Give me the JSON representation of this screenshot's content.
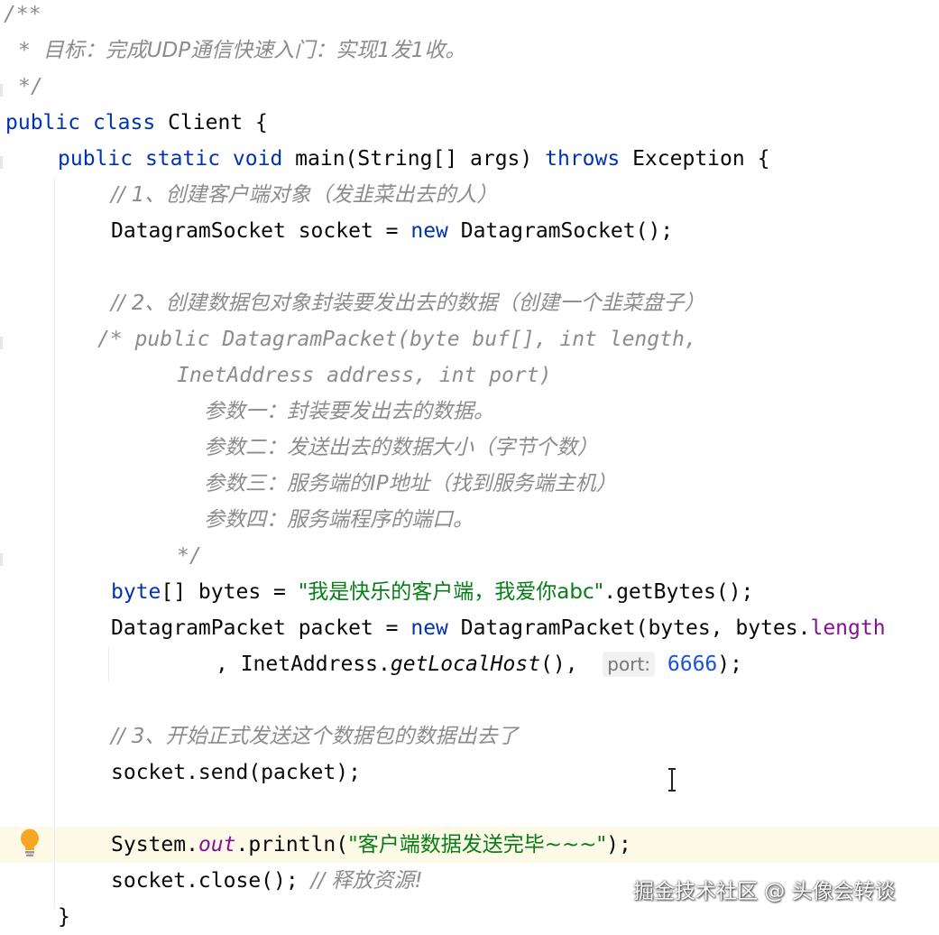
{
  "doc_comment": {
    "open": "/**",
    "star": "*",
    "text": "目标：完成UDP通信快速入门：实现1发1收。",
    "close": "*/"
  },
  "class_decl": {
    "kw1": "public",
    "kw2": "class",
    "name": "Client",
    "brace": "{"
  },
  "main_decl": {
    "kw1": "public",
    "kw2": "static",
    "kw3": "void",
    "signature": "main(String[] args)",
    "kw4": "throws",
    "exception": "Exception",
    "brace": "{"
  },
  "comment1": "// 1、创建客户端对象（发韭菜出去的人）",
  "socket_decl": {
    "type": "DatagramSocket socket = ",
    "kw": "new",
    "call": " DatagramSocket();"
  },
  "comment2": "// 2、创建数据包对象封装要发出去的数据（创建一个韭菜盘子）",
  "block_comment": {
    "line1": "/* public DatagramPacket(byte buf[], int length,",
    "line2": "InetAddress address, int port)",
    "param1": "参数一：封装要发出去的数据。",
    "param2": "参数二：发送出去的数据大小（字节个数）",
    "param3": "参数三：服务端的IP地址（找到服务端主机）",
    "param4": "参数四：服务端程序的端口。",
    "close": "*/"
  },
  "bytes_decl": {
    "kw": "byte",
    "rest": "[] bytes = ",
    "str": "\"我是快乐的客户端，我爱你abc\"",
    "call": ".getBytes();"
  },
  "packet_decl": {
    "lhs": "DatagramPacket packet = ",
    "kw": "new",
    "ctor": " DatagramPacket(bytes, bytes.",
    "field": "length"
  },
  "packet_cont": {
    "prefix": ", InetAddress.",
    "method": "getLocalHost",
    "mid": "(),",
    "hint_label": "port:",
    "port": "6666",
    "end": ");"
  },
  "comment3": "// 3、开始正式发送这个数据包的数据出去了",
  "send_line": "socket.send(packet);",
  "println_line": {
    "prefix": "System.",
    "field": "out",
    "call": ".println(",
    "str": "\"客户端数据发送完毕~~~\"",
    "end": ");"
  },
  "close_line": {
    "code": "socket.close();",
    "comment": "// 释放资源!"
  },
  "closing_brace": "}",
  "watermark": "掘金技术社区 @ 头像会转谈",
  "colors": {
    "keyword": "#0033b3",
    "comment": "#8c8c8c",
    "string": "#067d17",
    "number": "#1750eb",
    "field": "#871094",
    "highlight": "#fdfae8"
  }
}
